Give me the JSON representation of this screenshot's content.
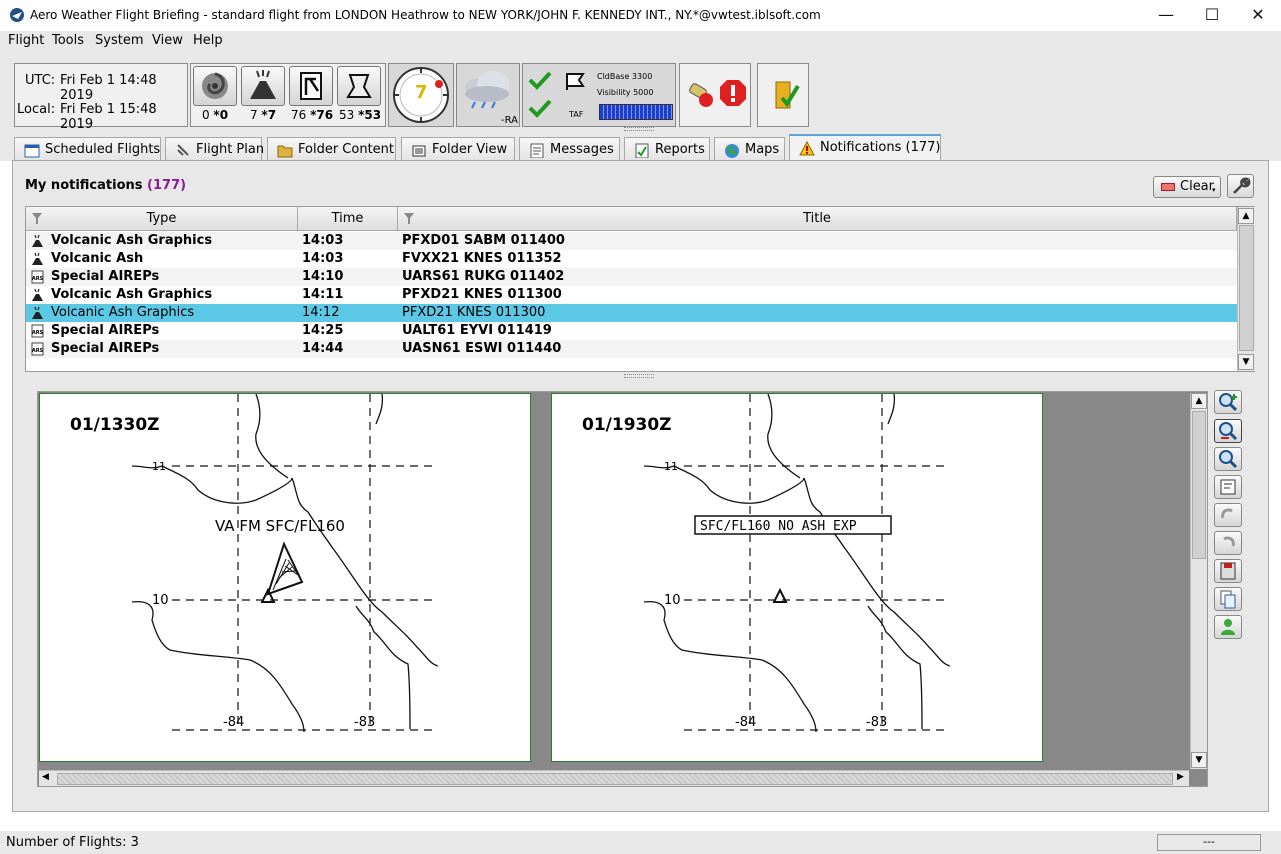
{
  "window": {
    "title": "Aero Weather Flight Briefing - standard flight from LONDON Heathrow to NEW YORK/JOHN F. KENNEDY INT., NY.*@vwtest.iblsoft.com",
    "minimize": "—",
    "maximize": "☐",
    "close": "✕"
  },
  "menu": [
    "Flight",
    "Tools",
    "System",
    "View",
    "Help"
  ],
  "clock": {
    "utc_label": "UTC:",
    "utc_value": "Fri Feb 1 14:48 2019",
    "local_label": "Local:",
    "local_value": "Fri Feb 1 15:48 2019"
  },
  "counters": [
    {
      "icon": "tropical-cyclone-icon",
      "plain": "0",
      "bold": "*0"
    },
    {
      "icon": "volcano-icon",
      "plain": "7",
      "bold": "*7"
    },
    {
      "icon": "route-sign-icon",
      "plain": "76",
      "bold": "*76"
    },
    {
      "icon": "airport-icon",
      "plain": "53",
      "bold": "*53"
    }
  ],
  "gauge": {
    "value": "7"
  },
  "weather": {
    "code": "-RA"
  },
  "taf": {
    "cldbase_label": "CldBase",
    "cldbase": "3300",
    "vis_label": "Visibility",
    "vis": "5000",
    "label": "TAF"
  },
  "tabs": [
    {
      "label": "Scheduled Flights",
      "icon": "calendar-icon"
    },
    {
      "label": "Flight Plan",
      "icon": "flight-plan-icon"
    },
    {
      "label": "Folder Content",
      "icon": "folder-icon"
    },
    {
      "label": "Folder View",
      "icon": "folder-view-icon"
    },
    {
      "label": "Messages",
      "icon": "messages-icon"
    },
    {
      "label": "Reports",
      "icon": "reports-icon"
    },
    {
      "label": "Maps",
      "icon": "globe-icon"
    },
    {
      "label": "Notifications (177)",
      "icon": "warning-icon"
    }
  ],
  "notifications": {
    "title": "My notifications",
    "count": "(177)",
    "clear": "Clear",
    "columns": [
      "Type",
      "Time",
      "Title"
    ],
    "rows": [
      {
        "icon": "volcano-icon",
        "type": "Volcanic Ash Graphics",
        "time": "14:03",
        "title": "PFXD01 SABM 011400",
        "unread": true
      },
      {
        "icon": "volcano-icon",
        "type": "Volcanic Ash",
        "time": "14:03",
        "title": "FVXX21 KNES 011352",
        "unread": true
      },
      {
        "icon": "airep-icon",
        "type": "Special AIREPs",
        "time": "14:10",
        "title": "UARS61 RUKG 011402",
        "unread": true
      },
      {
        "icon": "volcano-icon",
        "type": "Volcanic Ash Graphics",
        "time": "14:11",
        "title": "PFXD21 KNES 011300",
        "unread": true
      },
      {
        "icon": "volcano-icon",
        "type": "Volcanic Ash Graphics",
        "time": "14:12",
        "title": "PFXD21 KNES 011300",
        "unread": false,
        "selected": true
      },
      {
        "icon": "airep-icon",
        "type": "Special AIREPs",
        "time": "14:25",
        "title": "UALT61 EYVI 011419",
        "unread": true
      },
      {
        "icon": "airep-icon",
        "type": "Special AIREPs",
        "time": "14:44",
        "title": "UASN61 ESWI 011440",
        "unread": true
      }
    ]
  },
  "maps": [
    {
      "time": "01/1330Z",
      "label": "VA FM SFC/FL160",
      "lat_top": "11",
      "lat_mid": "10",
      "lon_left": "-84",
      "lon_right": "-83"
    },
    {
      "time": "01/1930Z",
      "label": "SFC/FL160 NO ASH EXP",
      "lat_top": "11",
      "lat_mid": "10",
      "lon_left": "-84",
      "lon_right": "-83"
    }
  ],
  "status": {
    "flights": "Number of Flights: 3",
    "right": "---"
  },
  "colors": {
    "selected_row": "#5bc8e6",
    "count": "#8a1a9a",
    "map_border": "#2f7a2f"
  }
}
